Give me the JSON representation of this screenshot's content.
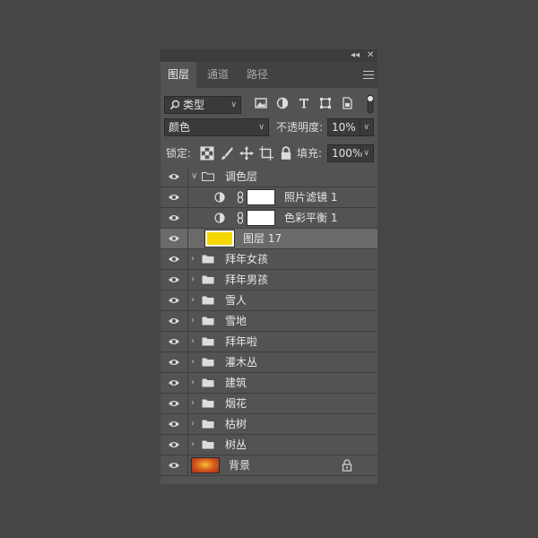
{
  "window": {
    "collapse_glyph": "◂◂",
    "close_glyph": "✕"
  },
  "tabs": [
    {
      "label": "图层",
      "active": true
    },
    {
      "label": "通道",
      "active": false
    },
    {
      "label": "路径",
      "active": false
    }
  ],
  "filter": {
    "kind_label": "类型",
    "icons": [
      "image-filter-icon",
      "adjustment-filter-icon",
      "type-filter-icon",
      "shape-filter-icon",
      "smart-object-filter-icon"
    ]
  },
  "blend": {
    "mode": "颜色",
    "opacity_label": "不透明度:",
    "opacity_value": "10%"
  },
  "lock": {
    "label": "锁定:",
    "fill_label": "填充:",
    "fill_value": "100%"
  },
  "layers": [
    {
      "name": "调色层",
      "type": "group",
      "expanded": true
    },
    {
      "name": "照片滤镜 1",
      "type": "adjustment"
    },
    {
      "name": "色彩平衡 1",
      "type": "adjustment"
    },
    {
      "name": "图层 17",
      "type": "pixel",
      "selected": true,
      "thumb_color": "#f5d800"
    },
    {
      "name": "拜年女孩",
      "type": "group"
    },
    {
      "name": "拜年男孩",
      "type": "group"
    },
    {
      "name": "雪人",
      "type": "group"
    },
    {
      "name": "雪地",
      "type": "group"
    },
    {
      "name": "拜年啦",
      "type": "group"
    },
    {
      "name": "灌木丛",
      "type": "group"
    },
    {
      "name": "建筑",
      "type": "group"
    },
    {
      "name": "烟花",
      "type": "group"
    },
    {
      "name": "枯树",
      "type": "group"
    },
    {
      "name": "树丛",
      "type": "group"
    },
    {
      "name": "背景",
      "type": "background",
      "locked": true
    }
  ],
  "colors": {
    "panel_bg": "#535353",
    "selected_row": "#6a6a6a",
    "yellow_fill": "#f5d800"
  }
}
